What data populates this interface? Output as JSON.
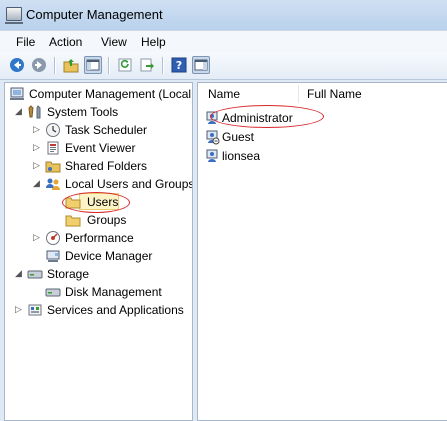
{
  "window": {
    "title": "Computer Management"
  },
  "menu": [
    "File",
    "Action",
    "View",
    "Help"
  ],
  "toolbar": {
    "buttons": [
      "back-arrow",
      "forward-arrow",
      "up-folder",
      "show-hide-console-tree",
      "refresh",
      "export-list",
      "help",
      "show-hide-action-pane"
    ]
  },
  "tree": {
    "root": "Computer Management (Local",
    "system_tools": "System Tools",
    "task_scheduler": "Task Scheduler",
    "event_viewer": "Event Viewer",
    "shared_folders": "Shared Folders",
    "local_users_groups": "Local Users and Groups",
    "users": "Users",
    "groups": "Groups",
    "performance": "Performance",
    "device_manager": "Device Manager",
    "storage": "Storage",
    "disk_management": "Disk Management",
    "services_apps": "Services and Applications",
    "selected": "Users"
  },
  "list": {
    "columns": [
      "Name",
      "Full Name"
    ],
    "rows": [
      {
        "name": "Administrator",
        "full_name": ""
      },
      {
        "name": "Guest",
        "full_name": ""
      },
      {
        "name": "lionsea",
        "full_name": ""
      }
    ]
  },
  "colors": {
    "annotation": "#d8262b",
    "selection": "#fcf3c6"
  }
}
